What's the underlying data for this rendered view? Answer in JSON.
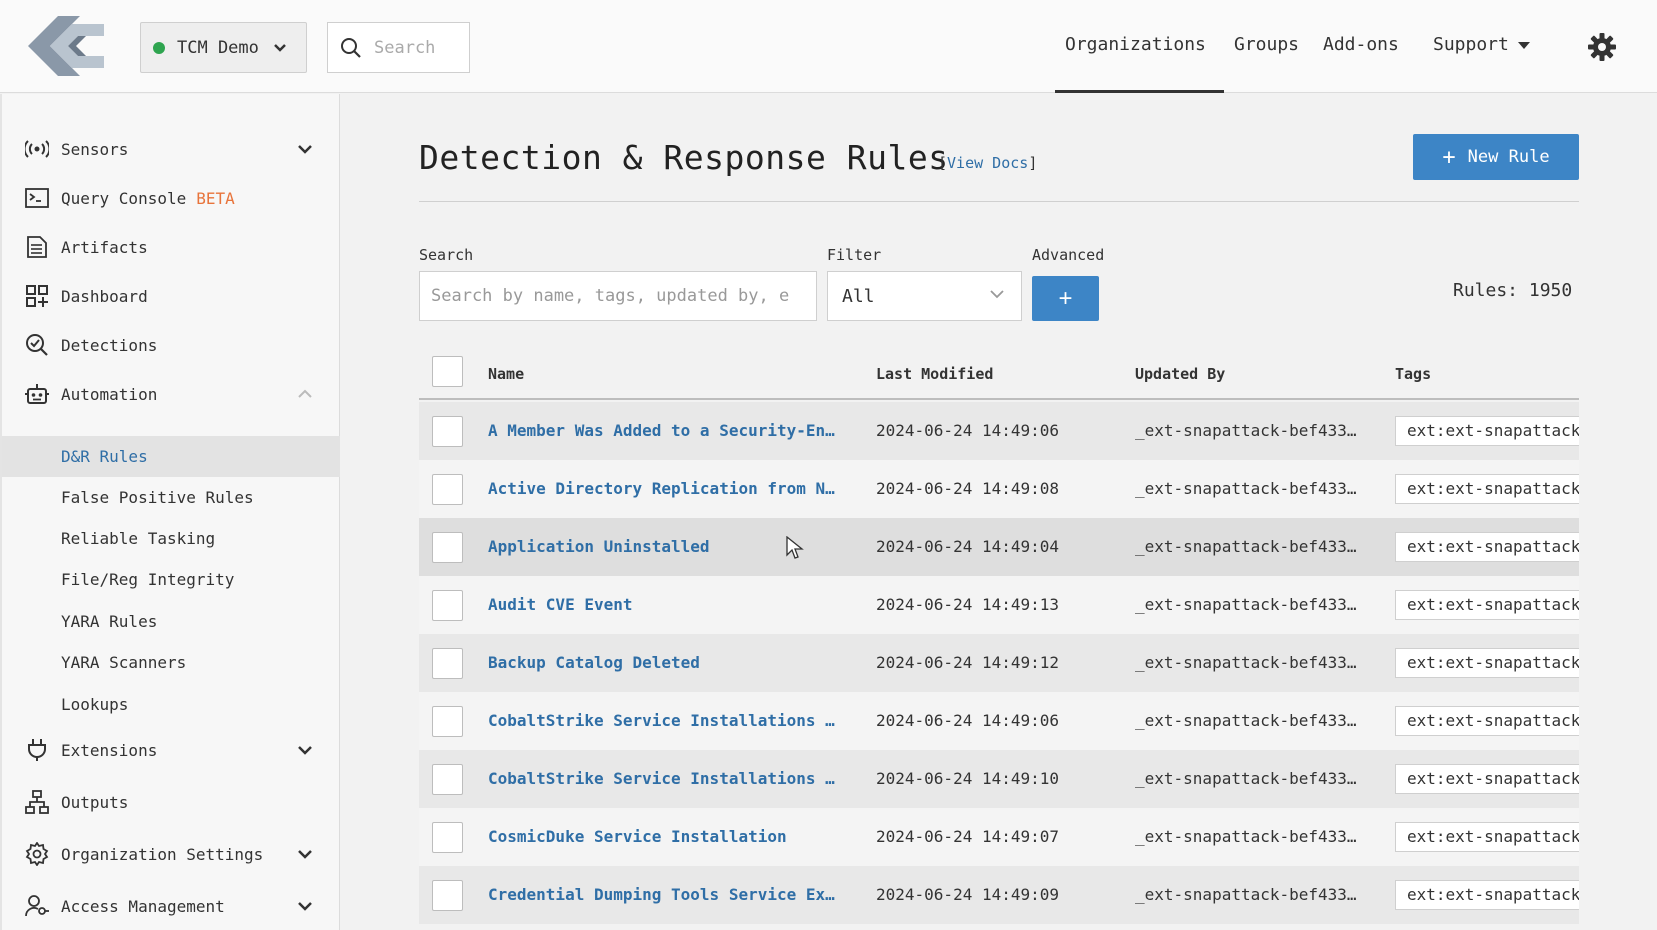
{
  "header": {
    "org_name": "TCM Demo",
    "search_placeholder": "Search",
    "nav": {
      "organizations": "Organizations",
      "groups": "Groups",
      "addons": "Add-ons",
      "support": "Support"
    },
    "accent_color": "#3d85c6",
    "status_color": "#2ea44f"
  },
  "sidebar": {
    "sensors": "Sensors",
    "query_console": "Query Console",
    "query_badge": "BETA",
    "artifacts": "Artifacts",
    "dashboard": "Dashboard",
    "detections": "Detections",
    "automation": "Automation",
    "sub": {
      "dr_rules": "D&R Rules",
      "false_positive": "False Positive Rules",
      "reliable_tasking": "Reliable Tasking",
      "file_reg": "File/Reg Integrity",
      "yara_rules": "YARA Rules",
      "yara_scanners": "YARA Scanners",
      "lookups": "Lookups"
    },
    "extensions": "Extensions",
    "outputs": "Outputs",
    "org_settings": "Organization Settings",
    "access_mgmt": "Access Management"
  },
  "main": {
    "title": "Detection & Response Rules",
    "view_docs": "View Docs",
    "new_rule": "New Rule",
    "search_label": "Search",
    "search_placeholder": "Search by name, tags, updated by, e",
    "filter_label": "Filter",
    "filter_value": "All",
    "advanced_label": "Advanced",
    "advanced_button": "+",
    "rules_count": "Rules: 1950"
  },
  "table": {
    "columns": {
      "name": "Name",
      "last_modified": "Last Modified",
      "updated_by": "Updated By",
      "tags": "Tags"
    },
    "rows": [
      {
        "name": "A Member Was Added to a Security-En…",
        "modified": "2024-06-24 14:49:06",
        "updated_by": "_ext-snapattack-bef433…",
        "tag": "ext:ext-snapattack"
      },
      {
        "name": "Active Directory Replication from N…",
        "modified": "2024-06-24 14:49:08",
        "updated_by": "_ext-snapattack-bef433…",
        "tag": "ext:ext-snapattack"
      },
      {
        "name": "Application Uninstalled",
        "modified": "2024-06-24 14:49:04",
        "updated_by": "_ext-snapattack-bef433…",
        "tag": "ext:ext-snapattack"
      },
      {
        "name": "Audit CVE Event",
        "modified": "2024-06-24 14:49:13",
        "updated_by": "_ext-snapattack-bef433…",
        "tag": "ext:ext-snapattack"
      },
      {
        "name": "Backup Catalog Deleted",
        "modified": "2024-06-24 14:49:12",
        "updated_by": "_ext-snapattack-bef433…",
        "tag": "ext:ext-snapattack"
      },
      {
        "name": "CobaltStrike Service Installations …",
        "modified": "2024-06-24 14:49:06",
        "updated_by": "_ext-snapattack-bef433…",
        "tag": "ext:ext-snapattack"
      },
      {
        "name": "CobaltStrike Service Installations …",
        "modified": "2024-06-24 14:49:10",
        "updated_by": "_ext-snapattack-bef433…",
        "tag": "ext:ext-snapattack"
      },
      {
        "name": "CosmicDuke Service Installation",
        "modified": "2024-06-24 14:49:07",
        "updated_by": "_ext-snapattack-bef433…",
        "tag": "ext:ext-snapattack"
      },
      {
        "name": "Credential Dumping Tools Service Ex…",
        "modified": "2024-06-24 14:49:09",
        "updated_by": "_ext-snapattack-bef433…",
        "tag": "ext:ext-snapattack"
      }
    ]
  }
}
